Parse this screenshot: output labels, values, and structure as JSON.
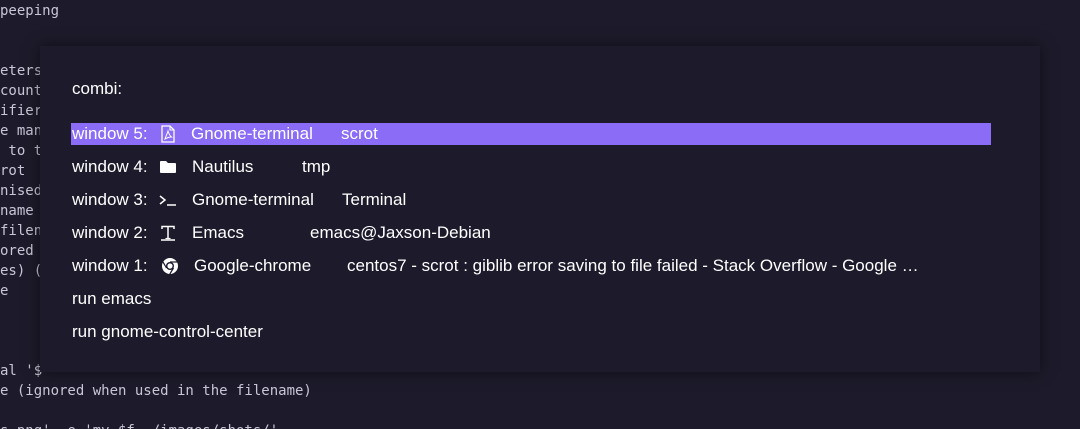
{
  "terminal": {
    "lines": [
      "peeping",
      "",
      "",
      "eters",
      "count",
      "ifier",
      "e man",
      " to t",
      "rot",
      "nised",
      "name",
      "filen",
      "ored",
      "es) (",
      "e",
      "",
      "",
      "al '$",
      "e (ignored when used in the filename)",
      "",
      "s.png' -e 'mv $f ~/images/shots/'"
    ]
  },
  "launcher": {
    "prompt": "combi:",
    "entries": [
      {
        "window": "window 5:",
        "icon": "pdf-document-icon",
        "class": "Gnome-terminal",
        "title": "scrot",
        "selected": true
      },
      {
        "window": "window 4:",
        "icon": "folder-icon",
        "class": "Nautilus",
        "title": "tmp",
        "selected": false
      },
      {
        "window": "window 3:",
        "icon": "terminal-prompt-icon",
        "class": "Gnome-terminal",
        "title": "Terminal",
        "selected": false
      },
      {
        "window": "window 2:",
        "icon": "text-editor-icon",
        "class": "Emacs",
        "title": "emacs@Jaxson-Debian",
        "selected": false
      },
      {
        "window": "window 1:",
        "icon": "chrome-icon",
        "class": "Google-chrome",
        "title": "centos7 - scrot : giblib error saving to file failed - Stack Overflow - Google …",
        "selected": false
      }
    ],
    "commands": [
      {
        "label": "run emacs"
      },
      {
        "label": "run gnome-control-center"
      }
    ]
  },
  "colors": {
    "background": "#1c1a2b",
    "selected": "#8a6cf6",
    "text": "#ffffff"
  }
}
